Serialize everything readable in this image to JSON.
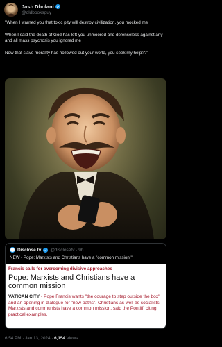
{
  "author": {
    "name": "Jash Dholani",
    "handle": "@oldbooksguy"
  },
  "tweet": {
    "paragraphs": [
      "\"When I warned you that toxic pity will destroy civilization, you mocked me",
      "When I said the death of God has left you unmoored and defenseless against any and all mass psychosis you ignored me",
      "Now that slave morality has hollowed out your world, you seek my help??\""
    ]
  },
  "quote_card": {
    "source_name": "Disclose.tv",
    "source_handle": "@disclosetv · 9h",
    "subtitle": "NEW - Pope: Marxists and Christians have a \"common mission.\"",
    "kicker": "Francis calls for overcoming divisive approaches",
    "headline": "Pope: Marxists and Christians have a common mission",
    "place": "VATICAN CITY",
    "body": " - Pope Francis wants \"the courage to step outside the box\" and an opening in dialogue for \"new paths\". Christians as well as socialists, Marxists and communists have a common mission, said the Pontiff, citing practical examples."
  },
  "footer": {
    "timestamp": "6:54 PM · Jan 13, 2024 · ",
    "views": "6,154",
    "views_label": " Views"
  },
  "colors": {
    "background": "#000000",
    "verified": "#1d9bf0",
    "kicker": "#a4182a"
  }
}
